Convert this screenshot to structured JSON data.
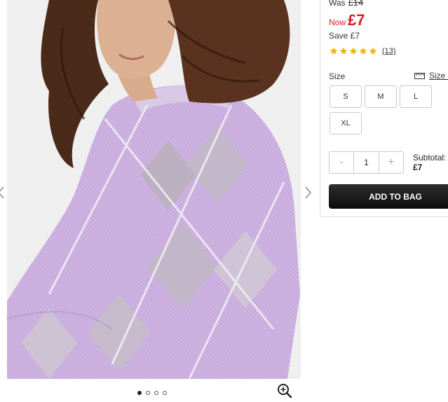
{
  "gallery": {
    "image_alt": "Model wearing a lilac argyle knit jumper",
    "slide_count": 4,
    "active_slide": 1
  },
  "product": {
    "was_label": "Was",
    "was_price": "£14",
    "now_label": "Now",
    "now_price": "£7",
    "save_text": "Save £7",
    "rating": 5,
    "review_count": "(13)",
    "size_label": "Size",
    "size_guide_label": "Size a",
    "sizes": [
      "S",
      "M",
      "L",
      "XL"
    ],
    "quantity": "1",
    "qty_minus": "-",
    "qty_plus": "+",
    "subtotal_label": "Subtotal:",
    "subtotal_value": "£7",
    "add_to_bag_label": "ADD TO BAG"
  },
  "colors": {
    "price_red": "#d62027",
    "star_gold": "#f3b311",
    "button_black": "#111111"
  },
  "icons": {
    "prev": "chevron-left-icon",
    "next": "chevron-right-icon",
    "zoom": "zoom-in-icon",
    "size_guide": "ruler-icon",
    "star": "star-icon"
  }
}
